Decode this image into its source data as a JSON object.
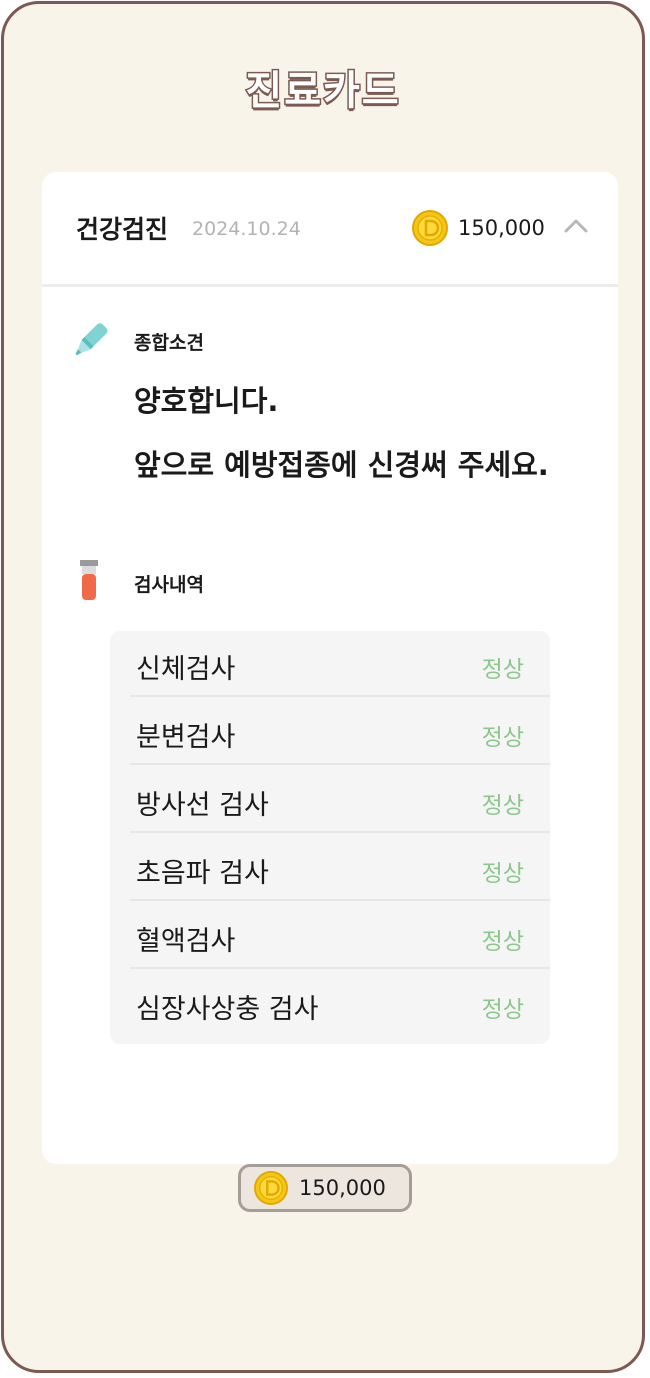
{
  "page": {
    "title": "진료카드"
  },
  "card": {
    "title": "건강검진",
    "date": "2024.10.24",
    "amount": "150,000",
    "coin_icon": "coin-icon",
    "toggle_icon": "chevron-up-icon",
    "opinion": {
      "icon": "highlighter-pen-icon",
      "label": "종합소견",
      "lines": [
        "양호합니다.",
        "앞으로 예방접종에 신경써 주세요."
      ]
    },
    "exams": {
      "icon": "test-tube-icon",
      "label": "검사내역",
      "items": [
        {
          "name": "신체검사",
          "result": "정상"
        },
        {
          "name": "분변검사",
          "result": "정상"
        },
        {
          "name": "방사선 검사",
          "result": "정상"
        },
        {
          "name": "초음파 검사",
          "result": "정상"
        },
        {
          "name": "혈액검사",
          "result": "정상"
        },
        {
          "name": "심장사상충 검사",
          "result": "정상"
        }
      ]
    }
  },
  "footer": {
    "amount": "150,000",
    "coin_icon": "coin-icon"
  },
  "colors": {
    "frame_border": "#7a5a52",
    "background": "#f8f4ea",
    "result_green": "#8cc78c",
    "coin_gold": "#f5c518"
  }
}
